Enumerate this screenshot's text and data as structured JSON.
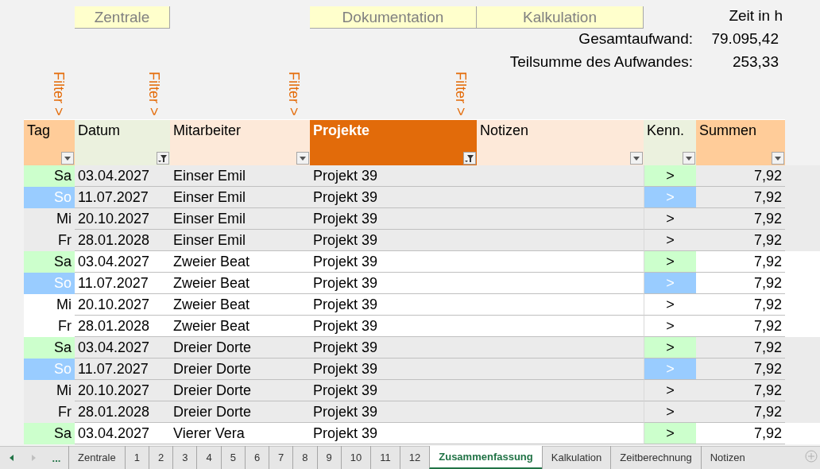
{
  "nav_buttons": [
    {
      "label": "Zentrale"
    },
    {
      "label": "Dokumentation"
    },
    {
      "label": "Kalkulation"
    }
  ],
  "summary": {
    "unit": "Zeit in h",
    "lines": [
      {
        "label": "Gesamtaufwand:",
        "value": "79.095,42"
      },
      {
        "label": "Teilsumme des Aufwandes:",
        "value": "253,33"
      }
    ]
  },
  "table": {
    "columns": [
      {
        "label": "Tag",
        "color": "#ffcc99",
        "highlighted": false,
        "filtered": false,
        "filter_hint": "Filter >"
      },
      {
        "label": "Datum",
        "color": "#ebf1de",
        "highlighted": false,
        "filtered": true,
        "filter_hint": "Filter >"
      },
      {
        "label": "Mitarbeiter",
        "color": "#fde9d9",
        "highlighted": false,
        "filtered": false,
        "filter_hint": "Filter >"
      },
      {
        "label": "Projekte",
        "color": "#e26b0a",
        "highlighted": true,
        "filtered": true,
        "filter_hint": "Filter >"
      },
      {
        "label": "Notizen",
        "color": "#fde9d9",
        "highlighted": false,
        "filtered": false
      },
      {
        "label": "Kenn.",
        "color": "#ebf1de",
        "highlighted": false,
        "filtered": false
      },
      {
        "label": "Summen",
        "color": "#ffcc99",
        "highlighted": false,
        "filtered": false
      }
    ],
    "rows": [
      {
        "kind": "saturday",
        "shaded": true,
        "cells": [
          "Sa",
          "03.04.2027",
          "Einser Emil",
          "Projekt 39",
          "",
          ">",
          "7,92"
        ]
      },
      {
        "kind": "sunday",
        "shaded": true,
        "cells": [
          "So",
          "11.07.2027",
          "Einser Emil",
          "Projekt 39",
          "",
          ">",
          "7,92"
        ]
      },
      {
        "kind": "weekday",
        "shaded": true,
        "cells": [
          "Mi",
          "20.10.2027",
          "Einser Emil",
          "Projekt 39",
          "",
          ">",
          "7,92"
        ]
      },
      {
        "kind": "weekday",
        "shaded": true,
        "cells": [
          "Fr",
          "28.01.2028",
          "Einser Emil",
          "Projekt 39",
          "",
          ">",
          "7,92"
        ]
      },
      {
        "kind": "saturday",
        "shaded": false,
        "cells": [
          "Sa",
          "03.04.2027",
          "Zweier Beat",
          "Projekt 39",
          "",
          ">",
          "7,92"
        ]
      },
      {
        "kind": "sunday",
        "shaded": false,
        "cells": [
          "So",
          "11.07.2027",
          "Zweier Beat",
          "Projekt 39",
          "",
          ">",
          "7,92"
        ]
      },
      {
        "kind": "weekday",
        "shaded": false,
        "cells": [
          "Mi",
          "20.10.2027",
          "Zweier Beat",
          "Projekt 39",
          "",
          ">",
          "7,92"
        ]
      },
      {
        "kind": "weekday",
        "shaded": false,
        "cells": [
          "Fr",
          "28.01.2028",
          "Zweier Beat",
          "Projekt 39",
          "",
          ">",
          "7,92"
        ]
      },
      {
        "kind": "saturday",
        "shaded": true,
        "cells": [
          "Sa",
          "03.04.2027",
          "Dreier Dorte",
          "Projekt 39",
          "",
          ">",
          "7,92"
        ]
      },
      {
        "kind": "sunday",
        "shaded": true,
        "cells": [
          "So",
          "11.07.2027",
          "Dreier Dorte",
          "Projekt 39",
          "",
          ">",
          "7,92"
        ]
      },
      {
        "kind": "weekday",
        "shaded": true,
        "cells": [
          "Mi",
          "20.10.2027",
          "Dreier Dorte",
          "Projekt 39",
          "",
          ">",
          "7,92"
        ]
      },
      {
        "kind": "weekday",
        "shaded": true,
        "cells": [
          "Fr",
          "28.01.2028",
          "Dreier Dorte",
          "Projekt 39",
          "",
          ">",
          "7,92"
        ]
      },
      {
        "kind": "saturday",
        "shaded": false,
        "cells": [
          "Sa",
          "03.04.2027",
          "Vierer Vera",
          "Projekt 39",
          "",
          ">",
          "7,92"
        ]
      }
    ]
  },
  "sheet_tabs": {
    "more": "...",
    "tabs": [
      {
        "label": "Zentrale",
        "selected": false
      },
      {
        "label": "1",
        "selected": false
      },
      {
        "label": "2",
        "selected": false
      },
      {
        "label": "3",
        "selected": false
      },
      {
        "label": "4",
        "selected": false
      },
      {
        "label": "5",
        "selected": false
      },
      {
        "label": "6",
        "selected": false
      },
      {
        "label": "7",
        "selected": false
      },
      {
        "label": "8",
        "selected": false
      },
      {
        "label": "9",
        "selected": false
      },
      {
        "label": "10",
        "selected": false
      },
      {
        "label": "11",
        "selected": false
      },
      {
        "label": "12",
        "selected": false
      },
      {
        "label": "Zusammenfassung",
        "selected": true
      },
      {
        "label": "Kalkulation",
        "selected": false
      },
      {
        "label": "Zeitberechnung",
        "selected": false
      },
      {
        "label": "Notizen",
        "selected": false
      }
    ]
  }
}
